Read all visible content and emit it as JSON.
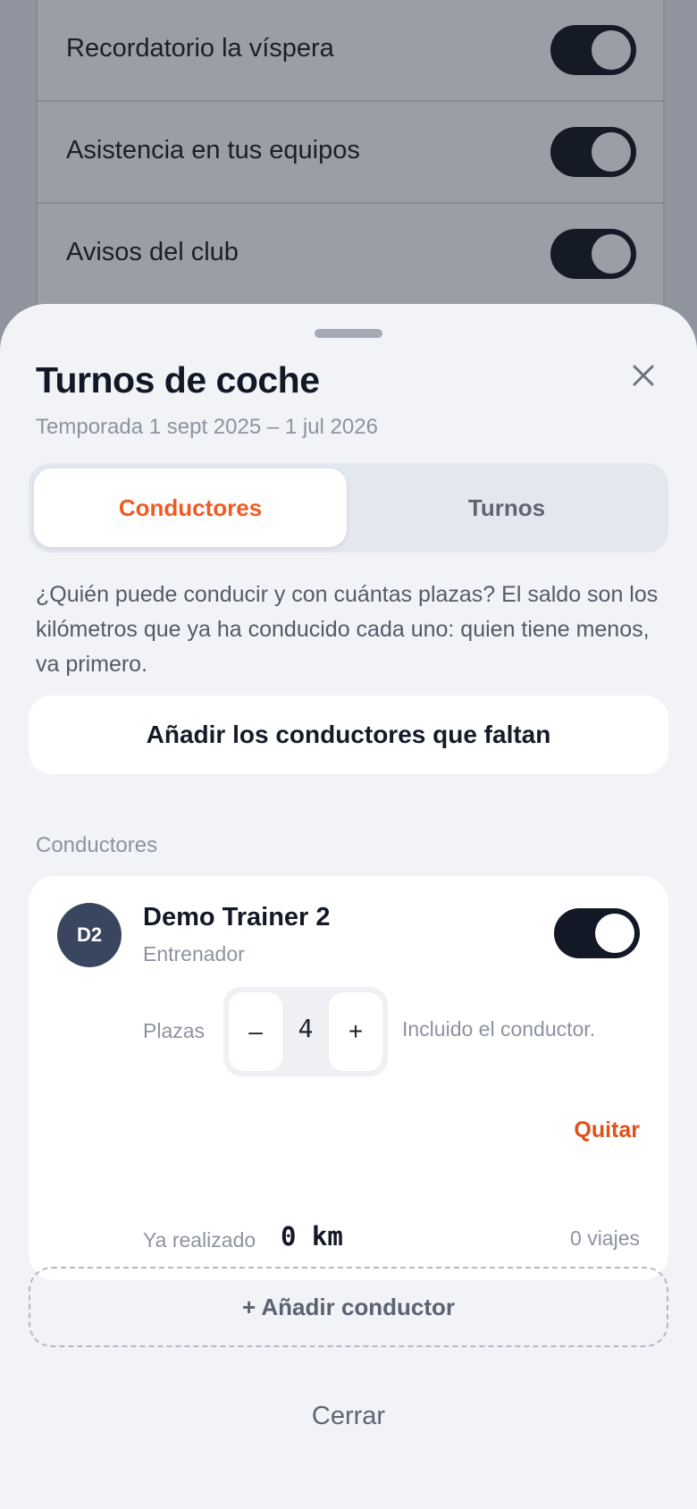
{
  "background": {
    "settings": [
      {
        "label": "Recordatorio la víspera",
        "enabled": true
      },
      {
        "label": "Asistencia en tus equipos",
        "enabled": true
      },
      {
        "label": "Avisos del club",
        "enabled": true
      }
    ]
  },
  "sheet": {
    "title": "Turnos de coche",
    "subtitle": "Temporada 1 sept 2025 – 1 jul 2026",
    "close_icon": "close-icon",
    "tabs": [
      {
        "label": "Conductores",
        "active": true
      },
      {
        "label": "Turnos",
        "active": false
      }
    ],
    "description": "¿Quién puede conducir y con cuántas plazas? El saldo son los kilómetros que ya ha conducido cada uno: quien tiene menos, va primero.",
    "add_missing_label": "Añadir los conductores que faltan",
    "section_label": "Conductores",
    "driver": {
      "initials": "D2",
      "name": "Demo Trainer 2",
      "role": "Entrenador",
      "enabled": true,
      "seats_label": "Plazas",
      "seats_value": "4",
      "minus_label": "–",
      "plus_label": "+",
      "seats_note": "Incluido el conductor.",
      "remove_label": "Quitar",
      "done_label": "Ya realizado",
      "done_value": "0 km",
      "trips": "0 viajes"
    },
    "add_driver_label": "+ Añadir conductor",
    "close_label": "Cerrar"
  },
  "colors": {
    "accent": "#f15a24",
    "danger": "#e0501c",
    "toggle_on": "#121826",
    "avatar": "#3a4660"
  }
}
